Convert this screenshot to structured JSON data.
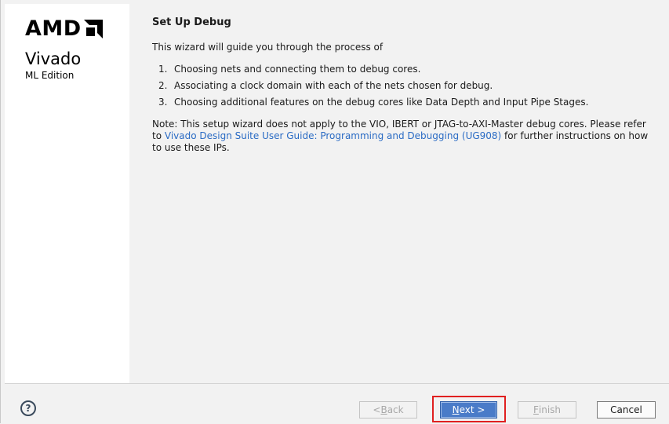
{
  "sidebar": {
    "brand": "AMD",
    "product": "Vivado",
    "edition": "ML Edition"
  },
  "page": {
    "title": "Set Up Debug",
    "intro": "This wizard will guide you through the process of",
    "steps": [
      {
        "num": "1.",
        "text": "Choosing nets and connecting them to debug cores."
      },
      {
        "num": "2.",
        "text": "Associating a clock domain with each of the nets chosen for debug."
      },
      {
        "num": "3.",
        "text": "Choosing additional features on the debug cores like Data Depth and Input Pipe Stages."
      }
    ],
    "note_prefix": "Note: This setup wizard does not apply to the VIO, IBERT or JTAG-to-AXI-Master debug cores. Please refer to ",
    "note_link": "Vivado Design Suite User Guide: Programming and Debugging (UG908)",
    "note_suffix": " for further instructions on how to use these IPs."
  },
  "footer": {
    "help_glyph": "?",
    "back_mnemonic": "B",
    "back_rest": "ack",
    "back_prefix": "< ",
    "next_mnemonic": "N",
    "next_rest": "ext >",
    "finish_mnemonic": "F",
    "finish_rest": "inish",
    "cancel_label": "Cancel"
  },
  "colors": {
    "link": "#2a6bc4",
    "primary_button": "#4a7bc8",
    "highlight_frame": "#e02020"
  }
}
